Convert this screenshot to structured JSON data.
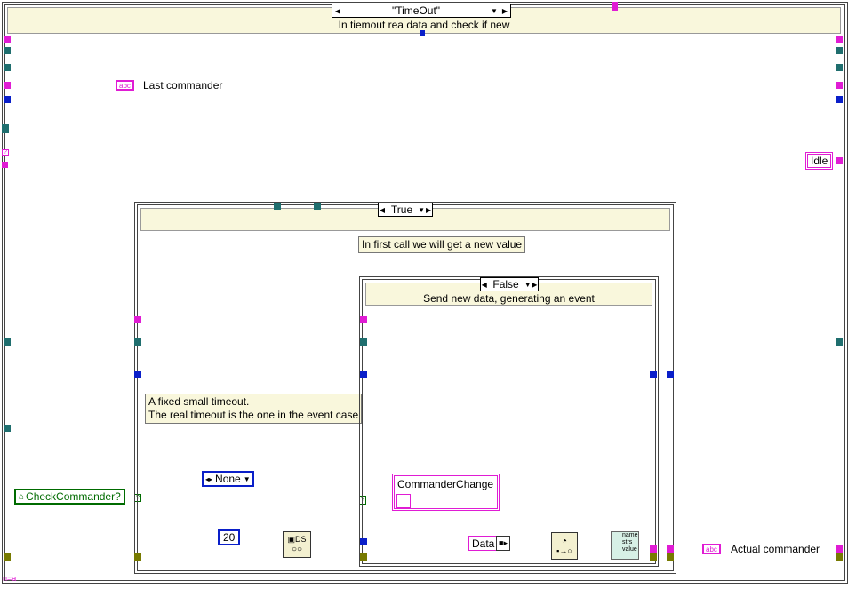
{
  "outer_case": {
    "selector": "\"TimeOut\"",
    "subdiagram_label": "In tiemout rea data and check if new"
  },
  "true_case": {
    "selector": "True",
    "comment": "In first call we will get a new value"
  },
  "false_case": {
    "selector": "False",
    "subdiagram_label": "Send new data, generating an event"
  },
  "labels": {
    "last_commander": "Last commander",
    "actual_commander": "Actual commander",
    "check_commander": "CheckCommander?",
    "timeout_comment": [
      "A fixed small timeout.",
      "The real timeout is the one in the event case"
    ],
    "abc": "abc",
    "bottom_left": "n=a"
  },
  "constants": {
    "idle": "Idle",
    "none": "None",
    "twenty": "20",
    "commander_change": "CommanderChange",
    "data": "Data",
    "bundle_items": [
      "name",
      "strs",
      "value"
    ]
  },
  "colors": {
    "string_wire": "#e01cd4",
    "numeric_wire": "#0a1fc9",
    "refnum_wire": "#1f6e6e",
    "error_wire": "#777a00",
    "boolean_wire": "#006b00",
    "case_label_bg": "#f9f7dc"
  }
}
